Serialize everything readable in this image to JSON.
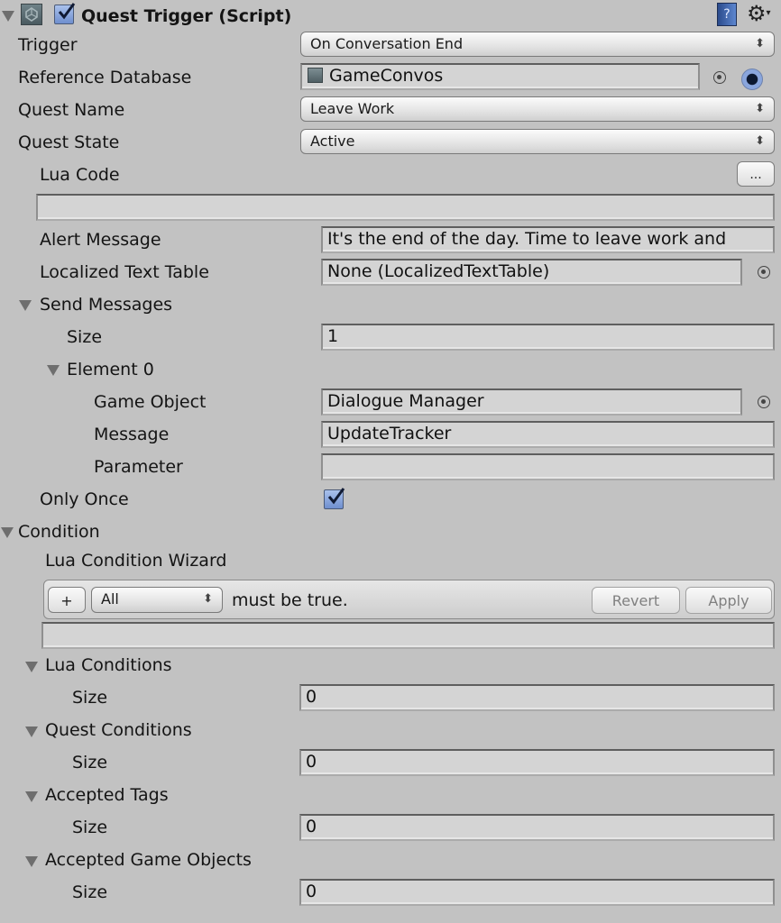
{
  "component": {
    "title": "Quest Trigger (Script)",
    "enabled": true,
    "icons": {
      "foldout": "triangle-down-icon",
      "script": "unity-script-icon",
      "help": "help-book-icon",
      "settings": "gear-icon"
    }
  },
  "fields": {
    "trigger": {
      "label": "Trigger",
      "value": "On Conversation End"
    },
    "reference_database": {
      "label": "Reference Database",
      "value": "GameConvos"
    },
    "quest_name": {
      "label": "Quest Name",
      "value": "Leave Work"
    },
    "quest_state": {
      "label": "Quest State",
      "value": "Active"
    },
    "lua_code": {
      "label": "Lua Code",
      "button": "...",
      "value": ""
    },
    "alert_message": {
      "label": "Alert Message",
      "value": "It's the end of the day. Time to leave work and"
    },
    "localized_text_table": {
      "label": "Localized Text Table",
      "value": "None (LocalizedTextTable)"
    },
    "send_messages": {
      "label": "Send Messages",
      "size_label": "Size",
      "size": "1",
      "element": {
        "label": "Element 0",
        "game_object": {
          "label": "Game Object",
          "value": "Dialogue Manager"
        },
        "message": {
          "label": "Message",
          "value": "UpdateTracker"
        },
        "parameter": {
          "label": "Parameter",
          "value": ""
        }
      }
    },
    "only_once": {
      "label": "Only Once",
      "checked": true
    }
  },
  "condition": {
    "label": "Condition",
    "wizard": {
      "label": "Lua Condition Wizard",
      "add_button": "+",
      "mode": "All",
      "suffix": "must be true.",
      "revert": "Revert",
      "apply": "Apply",
      "code": ""
    },
    "lists": [
      {
        "label": "Lua Conditions",
        "size_label": "Size",
        "size": "0"
      },
      {
        "label": "Quest Conditions",
        "size_label": "Size",
        "size": "0"
      },
      {
        "label": "Accepted Tags",
        "size_label": "Size",
        "size": "0"
      },
      {
        "label": "Accepted Game Objects",
        "size_label": "Size",
        "size": "0"
      }
    ]
  },
  "colors": {
    "background": "#c2c2c2",
    "field": "#d4d4d4",
    "checkbox": "#7f9ad8"
  }
}
